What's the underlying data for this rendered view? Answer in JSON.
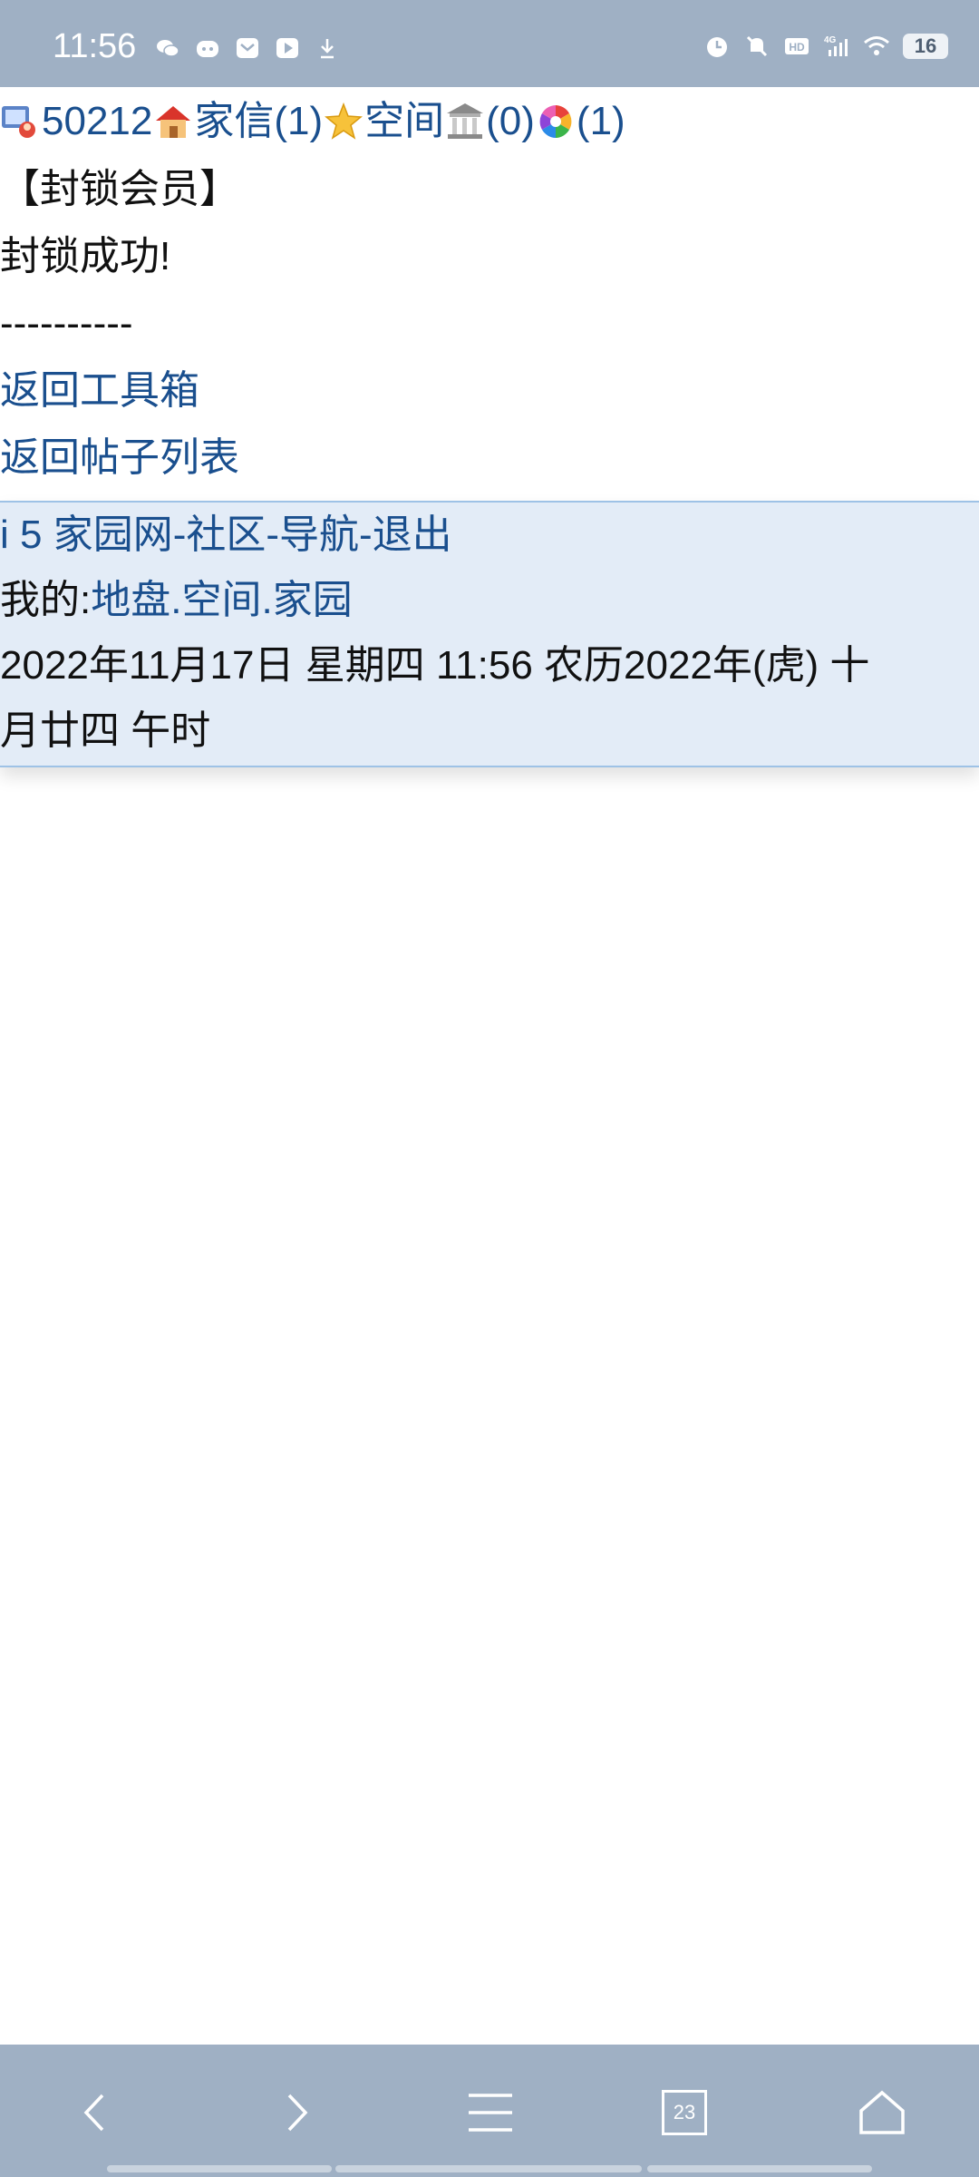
{
  "status_bar": {
    "time": "11:56",
    "battery": "16",
    "left_icons": [
      "wechat-icon",
      "cat-app-icon",
      "mail-icon",
      "play-icon",
      "download-icon"
    ],
    "right_icons": [
      "alarm-icon",
      "mute-icon",
      "hd-icon",
      "signal-4g-icon",
      "wifi-icon"
    ]
  },
  "header": {
    "user_id": "50212",
    "mail_label": "家信(1)",
    "space_label": "空间",
    "building_count": "(0)",
    "photo_count": "(1)"
  },
  "main": {
    "section_title": "【封锁会员】",
    "message": "封锁成功!",
    "divider": "----------",
    "back_toolbox": "返回工具箱",
    "back_posts": "返回帖子列表"
  },
  "footer": {
    "site_name": "i 5 家园网",
    "sep1": "-",
    "community": "社区",
    "sep2": "-",
    "navigation": "导航",
    "sep3": "-",
    "logout": "退出",
    "my_label": "我的:",
    "my_land": "地盘",
    "dot1": ".",
    "my_space": "空间",
    "dot2": ".",
    "my_home": "家园",
    "datetime": "2022年11月17日  星期四  11:56  农历2022年(虎)  十月廿四  午时"
  },
  "nav_bar": {
    "tab_count": "23",
    "icons": [
      "back-icon",
      "forward-icon",
      "menu-icon",
      "tabs-icon",
      "home-icon"
    ]
  }
}
